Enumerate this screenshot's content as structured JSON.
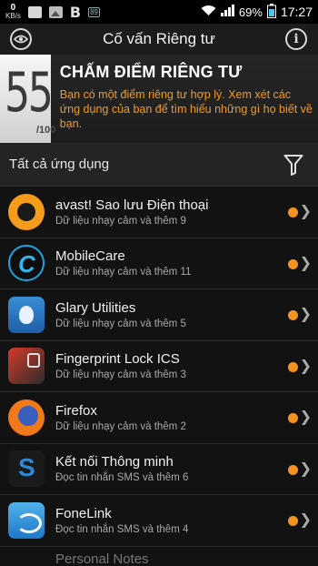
{
  "status_bar": {
    "speed_value": "0",
    "speed_unit": "KB/s",
    "b_icon": "B",
    "small_badge": "89",
    "battery_percent": "69%",
    "time": "17:27"
  },
  "header": {
    "title": "Cố vấn Riêng tư",
    "info_glyph": "i"
  },
  "score": {
    "value": "55",
    "max": "/100",
    "heading": "CHẤM ĐIỂM RIÊNG TƯ",
    "description": "Bạn có một điểm riêng tư hợp lý. Xem xét các ứng dụng của bạn để tìm hiểu những gì họ biết về bạn."
  },
  "filter": {
    "label": "Tất cả ứng dụng"
  },
  "apps": [
    {
      "name": "avast! Sao lưu Điện thoại",
      "detail": "Dữ liệu nhạy cảm và thêm 9",
      "icon": "avast-icon"
    },
    {
      "name": "MobileCare",
      "detail": "Dữ liệu nhạy cảm và thêm 11",
      "icon": "mobilecare-icon"
    },
    {
      "name": "Glary Utilities",
      "detail": "Dữ liệu nhạy cảm và thêm 5",
      "icon": "glary-icon"
    },
    {
      "name": "Fingerprint Lock ICS",
      "detail": "Dữ liệu nhạy cảm và thêm 3",
      "icon": "fingerprint-lock-icon"
    },
    {
      "name": "Firefox",
      "detail": "Dữ liệu nhạy cảm và thêm 2",
      "icon": "firefox-icon"
    },
    {
      "name": "Kết nối Thông minh",
      "detail": "Đọc tin nhắn SMS và thêm 6",
      "icon": "smart-connect-icon"
    },
    {
      "name": "FoneLink",
      "detail": "Đọc tin nhắn SMS và thêm 4",
      "icon": "fonelink-icon"
    },
    {
      "name": "Personal Notes",
      "detail": "",
      "icon": "personal-notes-icon"
    }
  ],
  "colors": {
    "accent": "#f39a1e",
    "risk_dot": "#f5931e"
  }
}
